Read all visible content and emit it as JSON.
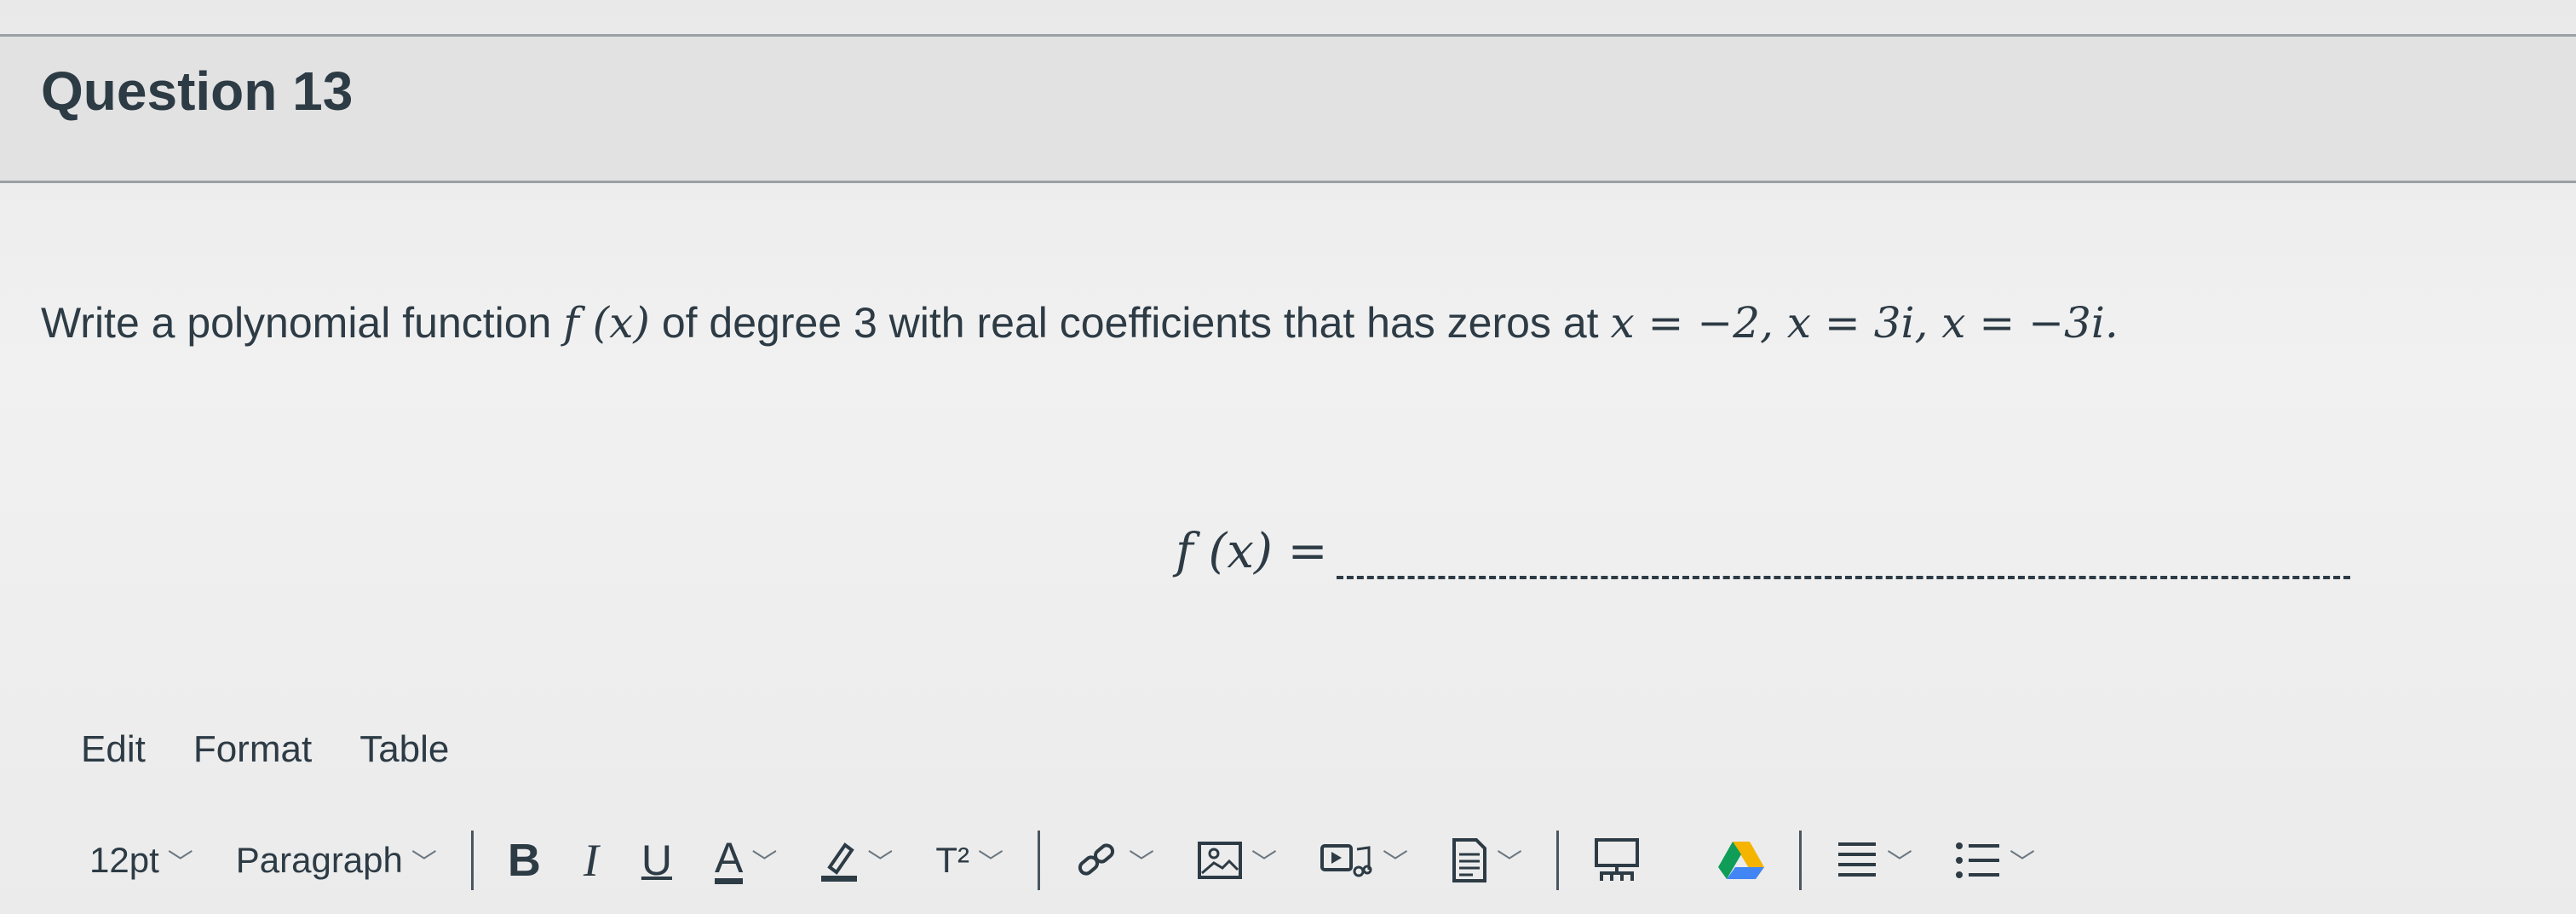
{
  "question": {
    "title": "Question 13",
    "prompt": "Write a polynomial function",
    "fx": "f (x)",
    "prompt_mid": "of degree 3 with real coefficients that has zeros at",
    "zeros": "x = −2, x = 3i, x = −3i.",
    "answer_label": "f (x) =",
    "answer_value": ""
  },
  "editor": {
    "menu": [
      "Edit",
      "Format",
      "Table"
    ],
    "font_size": "12pt",
    "block_format": "Paragraph",
    "bold": "B",
    "italic": "I",
    "underline": "U",
    "text_color": "A",
    "superscript": "T²"
  },
  "colors": {
    "text": "#2d3b45",
    "border": "#9aa0a5",
    "icon": "#4a5660"
  }
}
